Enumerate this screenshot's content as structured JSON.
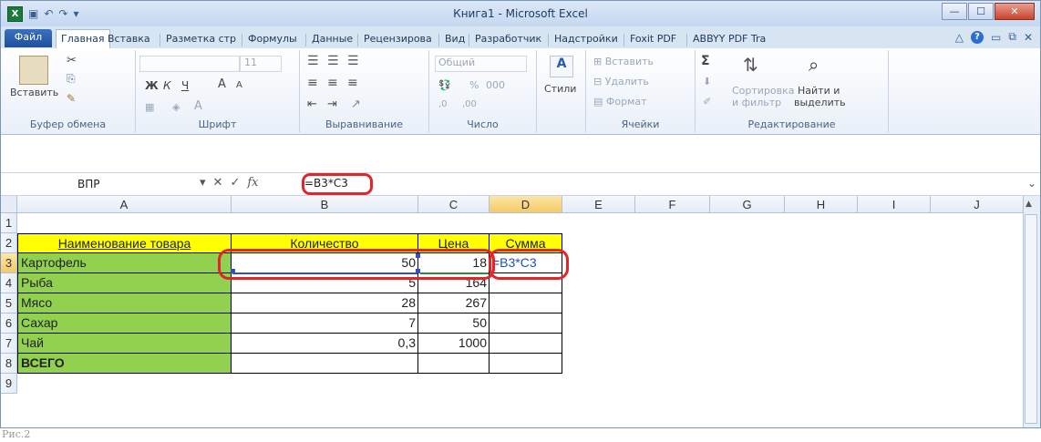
{
  "window": {
    "app_icon_letter": "X",
    "title": "Книга1 - Microsoft Excel",
    "min": "—",
    "max": "☐",
    "close": "✕"
  },
  "tabs": [
    "Файл",
    "Главная",
    "Вставка",
    "Разметка стр",
    "Формулы",
    "Данные",
    "Рецензирова",
    "Вид",
    "Разработчик",
    "Надстройки",
    "Foxit PDF",
    "ABBYY PDF Tra"
  ],
  "ribbon": {
    "clipboard": {
      "paste": "Вставить",
      "label": "Буфер обмена"
    },
    "font": {
      "size": "11",
      "bold": "Ж",
      "italic": "К",
      "underline": "Ч",
      "grow": "A",
      "shrink": "A",
      "color_a": "A",
      "label": "Шрифт"
    },
    "align": {
      "label": "Выравнивание"
    },
    "number": {
      "format": "Общий",
      "percent": "%",
      "thousands": "000",
      "inc": ",0",
      "dec": ",00",
      "label": "Число"
    },
    "styles": {
      "label": "Стили"
    },
    "cells": {
      "insert": "Вставить",
      "delete": "Удалить",
      "format": "Формат",
      "label": "Ячейки"
    },
    "editing": {
      "sum": "Σ",
      "sort1": "Сортировка",
      "sort2": "и фильтр",
      "find1": "Найти и",
      "find2": "выделить",
      "label": "Редактирование"
    }
  },
  "formula_bar": {
    "name_box": "ВПР",
    "fx": "fx",
    "cancel": "✕",
    "enter": "✓",
    "formula": "=B3*C3"
  },
  "columns": [
    "A",
    "B",
    "C",
    "D",
    "E",
    "F",
    "G",
    "H",
    "I",
    "J"
  ],
  "rows": [
    "1",
    "2",
    "3",
    "4",
    "5",
    "6",
    "7",
    "8",
    "9"
  ],
  "sheet": {
    "headers": {
      "name": "Наименование товара",
      "qty": "Количество",
      "price": "Цена",
      "sum": "Сумма"
    },
    "items": [
      {
        "name": "Картофель",
        "qty": "50",
        "price": "18",
        "sum": "=B3*C3"
      },
      {
        "name": "Рыба",
        "qty": "5",
        "price": "164",
        "sum": ""
      },
      {
        "name": "Мясо",
        "qty": "28",
        "price": "267",
        "sum": ""
      },
      {
        "name": "Сахар",
        "qty": "7",
        "price": "50",
        "sum": ""
      },
      {
        "name": "Чай",
        "qty": "0,3",
        "price": "1000",
        "sum": ""
      }
    ],
    "total": "ВСЕГО"
  },
  "caption": "Рис.2",
  "colors": {
    "header_yellow": "#ffff00",
    "name_green": "#92d050",
    "highlight_red": "#e0252b"
  }
}
